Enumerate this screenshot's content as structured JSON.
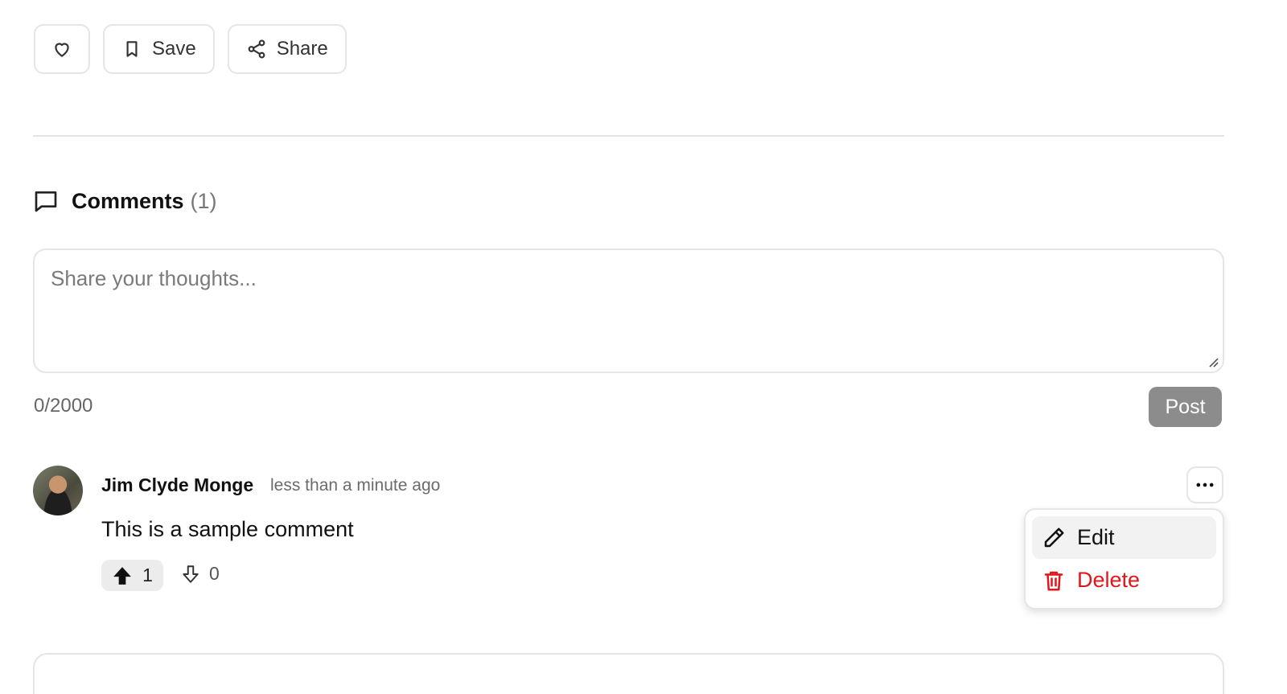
{
  "actions": {
    "like_icon": "heart-icon",
    "save_label": "Save",
    "save_icon": "bookmark-icon",
    "share_label": "Share",
    "share_icon": "share-icon"
  },
  "comments": {
    "title": "Comments",
    "count": "(1)",
    "composer_placeholder": "Share your thoughts...",
    "char_count": "0/2000",
    "post_label": "Post"
  },
  "comment": {
    "author": "Jim Clyde Monge",
    "time": "less than a minute ago",
    "text": "This is a sample comment",
    "upvotes": "1",
    "downvotes": "0"
  },
  "menu": {
    "edit_label": "Edit",
    "delete_label": "Delete"
  },
  "colors": {
    "danger": "#e0161b",
    "post_button_disabled": "#8c8c8c"
  }
}
